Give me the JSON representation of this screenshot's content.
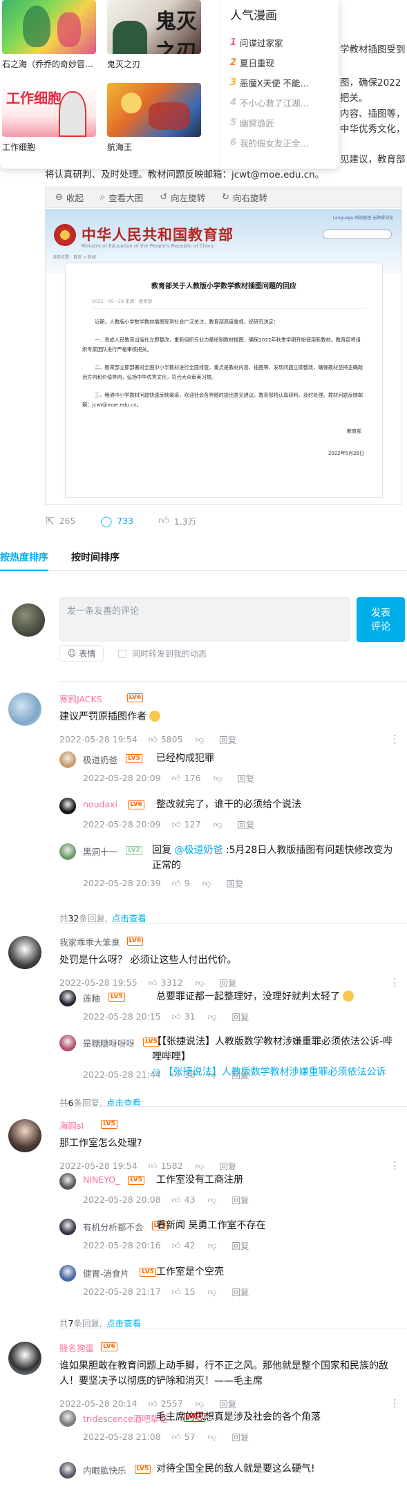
{
  "popup": {
    "tiles": [
      {
        "caption": "石之海（乔乔的奇妙冒…",
        "art_label": ""
      },
      {
        "caption": "鬼灭之刃",
        "art_label": "鬼灭之刃"
      },
      {
        "caption": "工作细胞",
        "art_label": "工作细胞"
      },
      {
        "caption": "航海王",
        "art_label": ""
      }
    ],
    "rank_title": "人气漫画",
    "rank_items": [
      {
        "num": "1",
        "title": "问谍过家家",
        "color": "#f25d8e"
      },
      {
        "num": "2",
        "title": "夏日重现",
        "color": "#ff7f24"
      },
      {
        "num": "3",
        "title": "恶魔X天使 不能…",
        "color": "#ffb027"
      },
      {
        "num": "4",
        "title": "不小心救了江湖…",
        "color": "#c9c9c9"
      },
      {
        "num": "5",
        "title": "幽冥诡匠",
        "color": "#c9c9c9"
      },
      {
        "num": "6",
        "title": "我的假女友正全…",
        "color": "#c9c9c9"
      }
    ]
  },
  "article": {
    "frag1": "学教材插图受到",
    "frag2": "图，确保2022",
    "frag3": "把关。",
    "frag4": "内容、插图等，",
    "frag5": "中华优秀文化，",
    "frag6": "见建议，教育部",
    "line_full": "将认真研判、及时处理。教材问题反映邮箱：jcwt@moe.edu.cn。"
  },
  "viewer": {
    "tools": [
      {
        "icon": "collapse-icon",
        "glyph": "⊖",
        "label": "收起"
      },
      {
        "icon": "zoom-icon",
        "glyph": "⌕",
        "label": "查看大图"
      },
      {
        "icon": "rotate-left-icon",
        "glyph": "↺",
        "label": "向左旋转"
      },
      {
        "icon": "rotate-right-icon",
        "glyph": "↻",
        "label": "向右旋转"
      }
    ],
    "site_title": "中华人民共和国教育部",
    "site_sub": "Ministry of Education of the People's Republic of China",
    "site_links": "Language   网站管理   无障碍浏览",
    "crumb": "当前位置：首页 > 新闻",
    "letter_title": "教育部关于人教版小学数学教材插图问题的回应",
    "letter_meta": "2022－05－28   来源：教育部",
    "p1": "近期，人教版小学数学教材插图受到社会广泛关注，教育部高度重视，经研究决定：",
    "p2": "一、责成人民教育出版社立即整改，重新组织专业力量绘制教材插图，确保2022年秋季学期开始使用新教材。教育部将组织专家团队进行严格审核把关。",
    "p3": "二、教育部立即部署对全国中小学教材进行全面排查，重点是教材内容、插图等，发现问题立即整改，确保教材坚持正确政治方向和价值导向，弘扬中华优秀文化，符合大众审美习惯。",
    "p4": "三、畅通中小学教材问题快速反映渠道，欢迎社会各界随时提出意见建议，教育部将认真研判、及时处理。教材问题反映邮箱：jcwt@moe.edu.cn。",
    "sign": "教育部",
    "date": "2022年5月28日"
  },
  "actions": {
    "forward": "265",
    "comment": "733",
    "like": "1.3万"
  },
  "sort": {
    "hot": "按热度排序",
    "time": "按时间排序"
  },
  "editor": {
    "placeholder": "发一条友善的评论",
    "send": "发表\n评论",
    "emoji": "表情",
    "forward": "同时转发到我的动态"
  },
  "comments": [
    {
      "user": "寒鸦JACKS",
      "level": "LV6",
      "text": "建议严罚原插图作者",
      "time": "2022-05-28 19:54",
      "likes": "5805",
      "reply_label": "回复",
      "replies": [
        {
          "user": "极道奶爸",
          "level": "LV5",
          "text": "已经构成犯罪",
          "time": "2022-05-28 20:09",
          "likes": "176"
        },
        {
          "user": "noudaxi",
          "level": "LV6",
          "text": "整改就完了，谁干的必须给个说法",
          "time": "2022-05-28 20:09",
          "likes": "127"
        },
        {
          "user": "黑洞十一",
          "level": "LV2",
          "text_prefix": "回复 ",
          "mention": "@极道奶爸",
          "text": " :5月28日人教版插图有问题快修改变为正常的",
          "time": "2022-05-28 20:39",
          "likes": "9"
        }
      ],
      "reply_total_pre": "共",
      "reply_total": "32",
      "reply_total_post": "条回复,",
      "view": "点击查看"
    },
    {
      "user": "我家乖乖大笨臭",
      "level": "LV6",
      "text": "处罚是什么呀？ 必须让这些人付出代价。",
      "time": "2022-05-28 19:55",
      "likes": "3312",
      "reply_label": "回复",
      "replies": [
        {
          "user": "莲釉",
          "level": "LV5",
          "text": "总要罪证都一起整理好，没理好就判太轻了",
          "time": "2022-05-28 20:15",
          "likes": "31"
        },
        {
          "user": "是糖糖呀呀呀",
          "level": "LV5",
          "text": "【【张捷说法】人教版数学教材涉嫌重罪必须依法公诉-哔哩哔哩】",
          "link": "【张捷说法】人教版数学教材涉嫌重罪必须依法公诉",
          "time": "2022-05-28 21:44",
          "likes": "38"
        }
      ],
      "reply_total_pre": "共",
      "reply_total": "6",
      "reply_total_post": "条回复,",
      "view": "点击查看"
    },
    {
      "user": "海鸥sl",
      "level": "LV5",
      "text": "那工作室怎么处理?",
      "time": "2022-05-28 19:54",
      "likes": "1582",
      "reply_label": "回复",
      "replies": [
        {
          "user": "NINEYO_",
          "level": "LV5",
          "text": "工作室没有工商注册",
          "time": "2022-05-28 20:08",
          "likes": "43"
        },
        {
          "user": "有机分析都不会",
          "level": "LV5",
          "text": "看新闻 吴勇工作室不存在",
          "time": "2022-05-28 20:16",
          "likes": "42"
        },
        {
          "user": "健胃-消食片",
          "level": "LV5",
          "text": "工作室是个空壳",
          "time": "2022-05-28 21:17",
          "likes": "15"
        }
      ],
      "reply_total_pre": "共",
      "reply_total": "7",
      "reply_total_post": "条回复,",
      "view": "点击查看"
    },
    {
      "user": "贱名狗蛋",
      "level": "LV6",
      "text": "谁如果胆敢在教育问题上动手脚，行不正之风。那他就是整个国家和民族的敌人！要坚决予以彻底的铲除和消灭！——毛主席",
      "time": "2022-05-28 20:14",
      "likes": "2557",
      "reply_label": "回复",
      "replies": [
        {
          "user": "tridescence酒吧挚枢",
          "level": "LV6+",
          "text": "毛主席的思想真是涉及社会的各个角落",
          "time": "2022-05-28 21:08",
          "likes": "57"
        },
        {
          "user": "内眼肱快乐",
          "level": "LV5",
          "text": "对待全国全民的敌人就是要这么硬气!",
          "time": "",
          "likes": ""
        }
      ]
    }
  ]
}
